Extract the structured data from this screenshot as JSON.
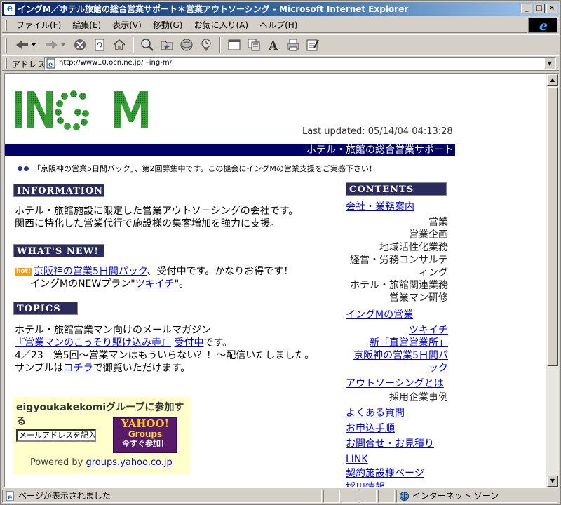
{
  "window": {
    "title": "イングM／ホテル旅館の総合営業サポート＊営業アウトソーシング - Microsoft Internet Explorer",
    "minimize": "_",
    "maximize": "□",
    "close": "×"
  },
  "menubar": [
    "ファイル(F)",
    "編集(E)",
    "表示(V)",
    "移動(G)",
    "お気に入り(A)",
    "ヘルプ(H)"
  ],
  "address": {
    "label": "アドレス",
    "url": "http://www10.ocn.ne.jp/~ing-m/"
  },
  "page": {
    "logo_text": "ING M",
    "last_updated": "Last updated: 05/14/04 04:13:28",
    "banner": "ホテル・旅館の総合営業サポート",
    "news": "「京阪神の営業5日間パック」、第2回募集中です。この機会にイングMの営業支援をご実感下さい！",
    "information": {
      "header": "INFORMATION",
      "line1": "ホテル・旅館施設に限定した営業アウトソーシングの会社です。",
      "line2": "関西に特化した営業代行で施設様の集客増加を強力に支援。"
    },
    "whats_new": {
      "header": "WHAT'S NEW!",
      "hot": "hot!",
      "link1": "京阪神の営業5日間パック",
      "text1": "、受付中です。かなりお得です！",
      "text2a": "イングMのNEWプラン\"",
      "link2": "ツキイチ",
      "text2b": "\"。"
    },
    "topics": {
      "header": "TOPICS",
      "line1": "ホテル・旅館営業マン向けのメールマガジン",
      "link_mag": "『営業マンのこっそり駆け込み寺』",
      "link_accept": "受付中",
      "line2_tail": "です。",
      "line3": "4／23　第5回〜営業マンはもういらない？！〜配信いたしました。",
      "line4_head": "サンプルは",
      "link_here": "コチラ",
      "line4_tail": "で御覧いただけます。"
    },
    "yahoo": {
      "title": "eigyoukakekomiグループに参加する",
      "input_value": "メールアドレスを記入",
      "btn_line1": "YAHOO!",
      "btn_line2": "Groups",
      "btn_line3": "今すぐ参加！",
      "powered": "Powered by",
      "powered_link": "groups.yahoo.co.jp"
    },
    "contents": {
      "header": "CONTENTS",
      "company_link": "会社・業務案内",
      "company_items": [
        "営業",
        "営業企画",
        "地域活性化業務",
        "経営・労務コンサルティング",
        "ホテル・旅館関連業務",
        "営業マン研修"
      ],
      "ingm_link": "イングMの営業",
      "ingm_sublinks": [
        "ツキイチ",
        "新「直営営業所」",
        "京阪神の営業5日間パック"
      ],
      "outsourcing_link": "アウトソーシングとは",
      "outsourcing_item": "採用企業事例",
      "links": [
        "よくある質問",
        "お申込手順",
        "お問合せ・お見積り",
        "LINK",
        "契約施設様ページ"
      ],
      "cut_text": "採用情報"
    }
  },
  "status": {
    "text": "ページが表示されました",
    "zone": "インターネット ゾーン"
  }
}
